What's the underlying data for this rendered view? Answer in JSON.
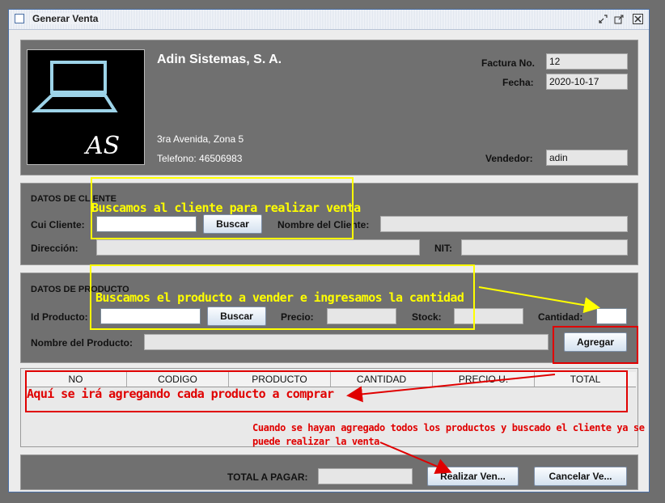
{
  "window": {
    "title": "Generar Venta"
  },
  "company": {
    "name": "Adin Sistemas, S. A.",
    "address": "3ra Avenida, Zona 5",
    "phone": "Telefono: 46506983",
    "logo_text": "AS"
  },
  "invoice": {
    "factura_label": "Factura No.",
    "factura_value": "12",
    "fecha_label": "Fecha:",
    "fecha_value": "2020-10-17",
    "vendedor_label": "Vendedor:",
    "vendedor_value": "adin"
  },
  "cliente": {
    "section_title": "DATOS DE CLIENTE",
    "cui_label": "Cui Cliente:",
    "cui_value": "",
    "buscar_label": "Buscar",
    "nombre_label": "Nombre del Cliente:",
    "nombre_value": "",
    "direccion_label": "Dirección:",
    "direccion_value": "",
    "nit_label": "NIT:",
    "nit_value": ""
  },
  "producto": {
    "section_title": "DATOS DE PRODUCTO",
    "id_label": "Id Producto:",
    "id_value": "",
    "buscar_label": "Buscar",
    "precio_label": "Precio:",
    "precio_value": "",
    "stock_label": "Stock:",
    "stock_value": "",
    "cantidad_label": "Cantidad:",
    "cantidad_value": "",
    "nombre_label": "Nombre del Producto:",
    "nombre_value": "",
    "agregar_label": "Agregar"
  },
  "table": {
    "columns": [
      "NO",
      "CODIGO",
      "PRODUCTO",
      "CANTIDAD",
      "PRECIO U.",
      "TOTAL"
    ],
    "rows": []
  },
  "footer": {
    "total_label": "TOTAL A PAGAR:",
    "total_value": "",
    "realizar_label": "Realizar Ven...",
    "cancelar_label": "Cancelar Ve..."
  },
  "annotations": {
    "cliente": "Buscamos al cliente para realizar venta",
    "producto": "Buscamos el producto a vender e ingresamos la cantidad",
    "tabla": "Aquí se irá agregando cada producto a comprar",
    "venta_line1": "Cuando se hayan agregado todos los productos y buscado el cliente ya se",
    "venta_line2": "puede realizar la venta"
  },
  "colors": {
    "yellow_annotation": "#ffff00",
    "red_annotation": "#e00000",
    "panel_bg": "#707070"
  }
}
